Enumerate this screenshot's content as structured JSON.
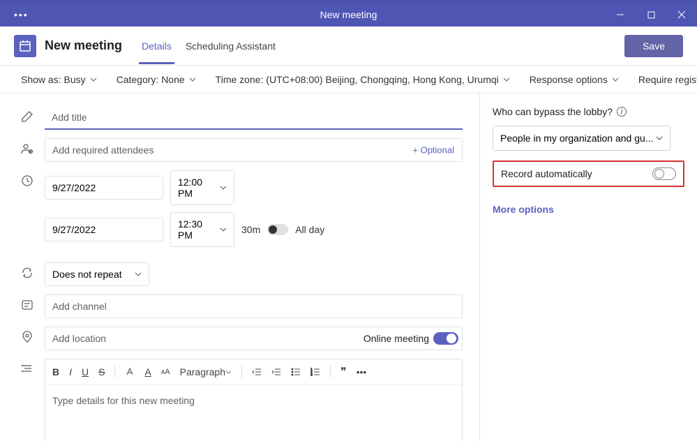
{
  "header": {
    "title": "New meeting"
  },
  "topbar": {
    "page_title": "New meeting",
    "tabs": [
      "Details",
      "Scheduling Assistant"
    ],
    "save": "Save"
  },
  "optbar": {
    "show_as": "Show as: Busy",
    "category": "Category: None",
    "timezone": "Time zone: (UTC+08:00) Beijing, Chongqing, Hong Kong, Urumqi",
    "response": "Response options",
    "registration": "Require registration: N"
  },
  "form": {
    "title_placeholder": "Add title",
    "attendees_placeholder": "Add required attendees",
    "optional": "+ Optional",
    "start_date": "9/27/2022",
    "start_time": "12:00 PM",
    "end_date": "9/27/2022",
    "end_time": "12:30 PM",
    "duration": "30m",
    "all_day": "All day",
    "repeat": "Does not repeat",
    "channel_placeholder": "Add channel",
    "location_placeholder": "Add location",
    "online_meeting": "Online meeting",
    "paragraph": "Paragraph",
    "details_placeholder": "Type details for this new meeting"
  },
  "side": {
    "lobby_label": "Who can bypass the lobby?",
    "lobby_value": "People in my organization and gu...",
    "record": "Record automatically",
    "more": "More options"
  }
}
